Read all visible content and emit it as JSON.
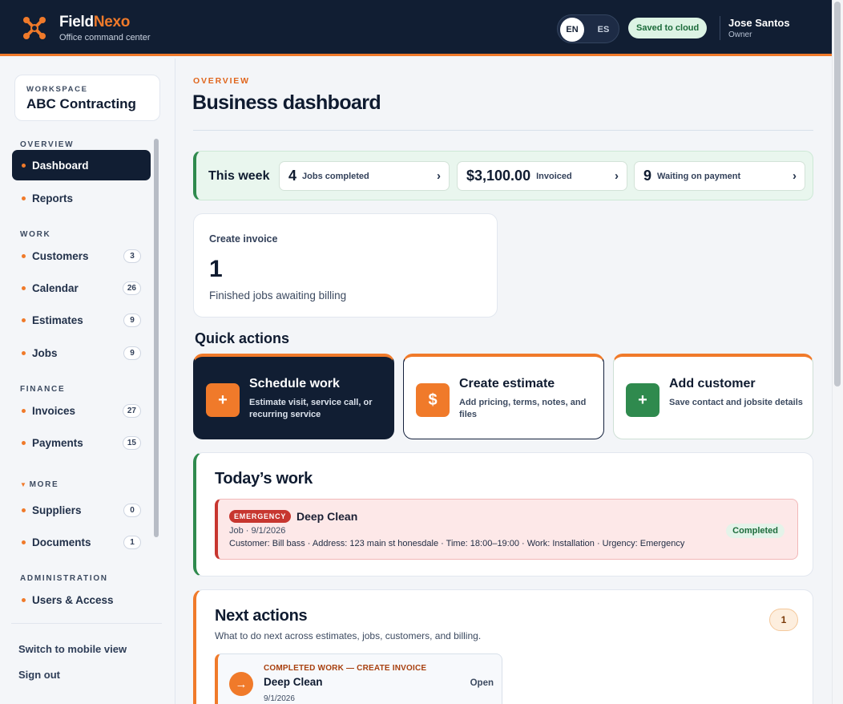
{
  "header": {
    "brand_part1": "Field",
    "brand_part2": "Nexo",
    "brand_sub": "Office command center",
    "lang_en": "EN",
    "lang_es": "ES",
    "saved_status": "Saved to cloud",
    "user_name": "Jose Santos",
    "user_role": "Owner",
    "accent_color": "#f07a2a"
  },
  "sidebar": {
    "workspace_label": "WORKSPACE",
    "workspace_name": "ABC Contracting",
    "sections": {
      "overview": "OVERVIEW",
      "work": "WORK",
      "finance": "FINANCE",
      "more": "MORE",
      "administration": "ADMINISTRATION"
    },
    "items": [
      {
        "label": "Dashboard",
        "active": true
      },
      {
        "label": "Reports"
      },
      {
        "label": "Customers",
        "count": "3"
      },
      {
        "label": "Calendar",
        "count": "26"
      },
      {
        "label": "Estimates",
        "count": "9"
      },
      {
        "label": "Jobs",
        "count": "9"
      },
      {
        "label": "Invoices",
        "count": "27"
      },
      {
        "label": "Payments",
        "count": "15"
      },
      {
        "label": "Suppliers",
        "count": "0"
      },
      {
        "label": "Documents",
        "count": "1"
      },
      {
        "label": "Users & Access"
      }
    ],
    "switch_mobile": "Switch to mobile view",
    "sign_out": "Sign out"
  },
  "main": {
    "eyebrow": "OVERVIEW",
    "title": "Business dashboard",
    "week": {
      "label": "This week",
      "stats": [
        {
          "value": "4",
          "label": "Jobs completed"
        },
        {
          "value": "$3,100.00",
          "label": "Invoiced"
        },
        {
          "value": "9",
          "label": "Waiting on payment"
        }
      ],
      "chevron": "›"
    },
    "invoice_card": {
      "title": "Create invoice",
      "count": "1",
      "subtitle": "Finished jobs awaiting billing"
    },
    "quick_actions": {
      "title": "Quick actions",
      "cards": [
        {
          "title": "Schedule work",
          "desc": "Estimate visit, service call, or recurring service",
          "icon": "+",
          "icon_color": "#f07a2a"
        },
        {
          "title": "Create estimate",
          "desc": "Add pricing, terms, notes, and files",
          "icon": "$",
          "icon_color": "#f07a2a"
        },
        {
          "title": "Add customer",
          "desc": "Save contact and jobsite details",
          "icon": "+",
          "icon_color": "#2f8a4e"
        }
      ]
    },
    "today": {
      "title": "Today’s work",
      "job": {
        "badge": "EMERGENCY",
        "title": "Deep Clean",
        "meta": "Job · 9/1/2026",
        "detail": "Customer: Bill bass · Address: 123 main st honesdale · Time: 18:00–19:00 · Work: Installation · Urgency: Emergency",
        "status": "Completed"
      }
    },
    "next_actions": {
      "title": "Next actions",
      "subtitle": "What to do next across estimates, jobs, customers, and billing.",
      "count": "1",
      "item": {
        "eyebrow": "COMPLETED WORK — CREATE INVOICE",
        "title": "Deep Clean",
        "date": "9/1/2026",
        "action": "Open",
        "icon": "→"
      }
    }
  }
}
